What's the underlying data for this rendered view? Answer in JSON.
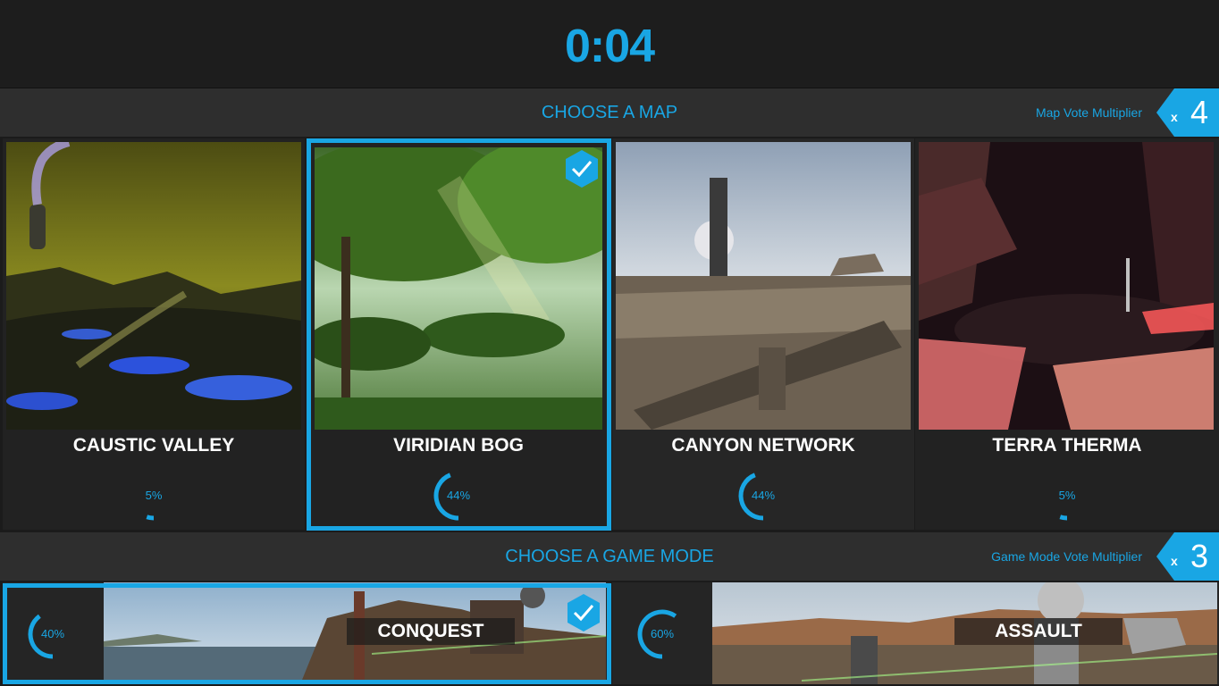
{
  "timer": "0:04",
  "map_section": {
    "title": "CHOOSE A MAP",
    "multiplier_label": "Map Vote Multiplier",
    "multiplier_x": "x",
    "multiplier_value": "4"
  },
  "maps": [
    {
      "name": "CAUSTIC VALLEY",
      "percent_label": "5%",
      "percent": 5,
      "selected": false
    },
    {
      "name": "VIRIDIAN BOG",
      "percent_label": "44%",
      "percent": 44,
      "selected": true
    },
    {
      "name": "CANYON NETWORK",
      "percent_label": "44%",
      "percent": 44,
      "selected": false
    },
    {
      "name": "TERRA THERMA",
      "percent_label": "5%",
      "percent": 5,
      "selected": false
    }
  ],
  "mode_section": {
    "title": "CHOOSE A GAME MODE",
    "multiplier_label": "Game Mode Vote Multiplier",
    "multiplier_x": "x",
    "multiplier_value": "3"
  },
  "modes": [
    {
      "name": "CONQUEST",
      "percent_label": "40%",
      "percent": 40,
      "selected": true
    },
    {
      "name": "ASSAULT",
      "percent_label": "60%",
      "percent": 60,
      "selected": false
    }
  ],
  "colors": {
    "accent": "#19a6e4",
    "panel": "#2e2e2e",
    "background": "#1b1b1b"
  }
}
